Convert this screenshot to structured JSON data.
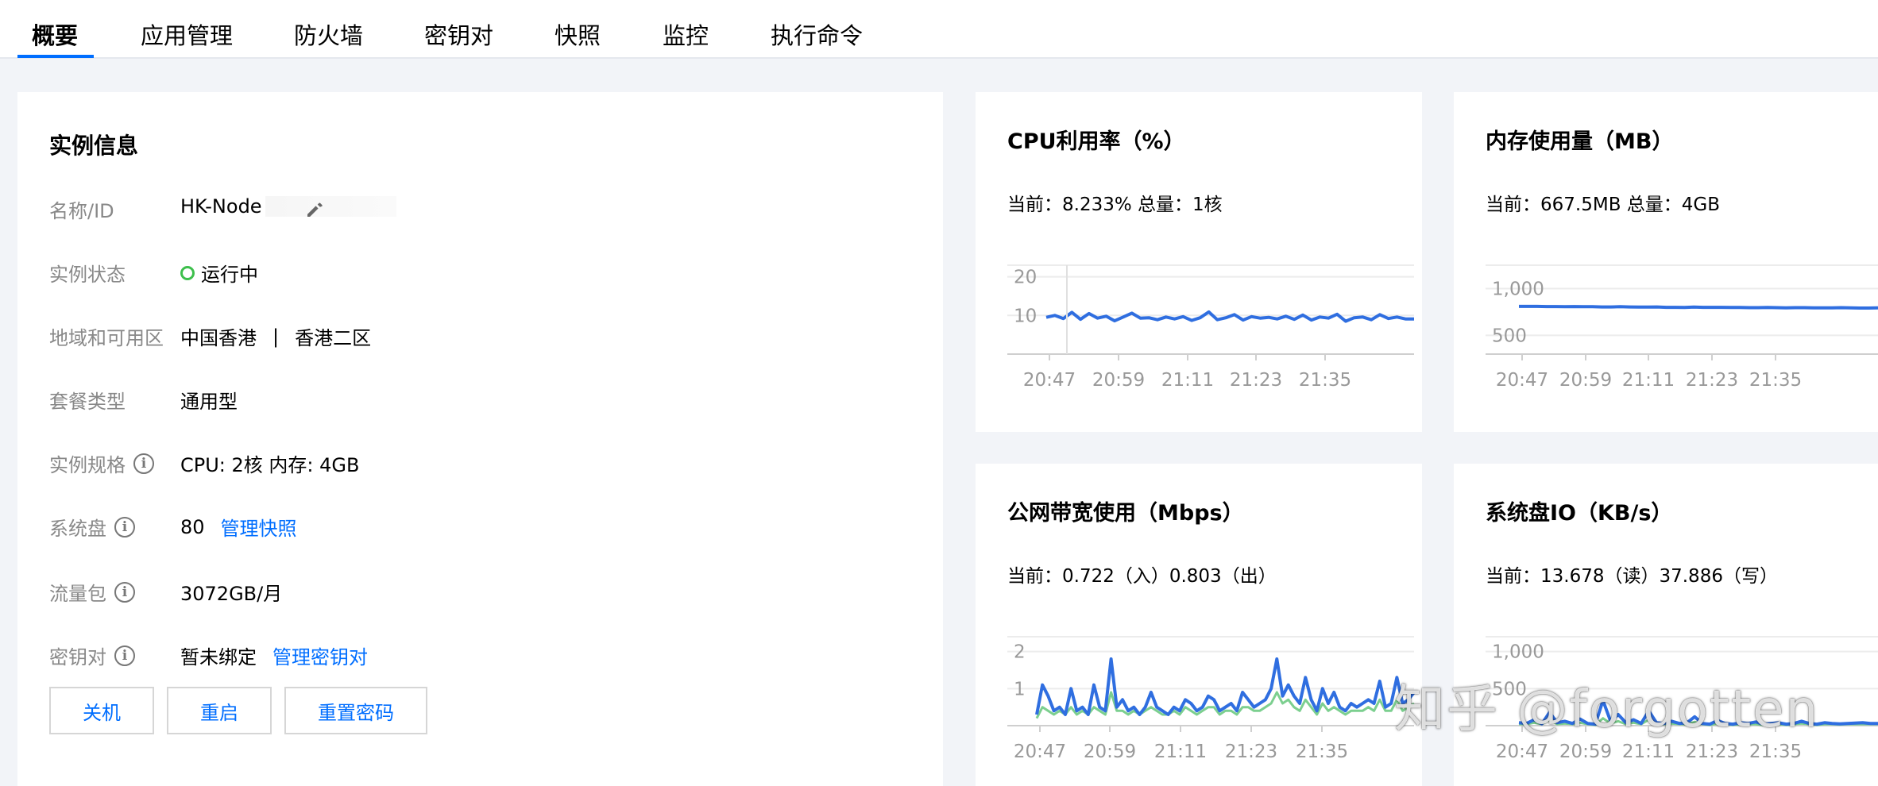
{
  "tabs": [
    {
      "label": "概要",
      "active": true
    },
    {
      "label": "应用管理"
    },
    {
      "label": "防火墙"
    },
    {
      "label": "密钥对"
    },
    {
      "label": "快照"
    },
    {
      "label": "监控"
    },
    {
      "label": "执行命令"
    }
  ],
  "instance": {
    "title": "实例信息",
    "name_label": "名称/ID",
    "name_value": "HK-Node",
    "status_label": "实例状态",
    "status_value": "运行中",
    "region_label": "地域和可用区",
    "region_value": "中国香港",
    "region_sep": "|",
    "zone_value": "香港二区",
    "plan_label": "套餐类型",
    "plan_value": "通用型",
    "spec_label": "实例规格",
    "spec_value": "CPU: 2核 内存: 4GB",
    "disk_label": "系统盘",
    "disk_value": "80",
    "disk_link": "管理快照",
    "traffic_label": "流量包",
    "traffic_value": "3072GB/月",
    "keypair_label": "密钥对",
    "keypair_value": "暂未绑定",
    "keypair_link": "管理密钥对",
    "buttons": {
      "shutdown": "关机",
      "restart": "重启",
      "reset_password": "重置密码"
    }
  },
  "colors": {
    "accent": "#006eff",
    "status_green": "#3dbf4c",
    "series_blue": "#2f6ee0",
    "series_green": "#7ccf8f"
  },
  "metrics": {
    "cpu": {
      "title": "CPU利用率（%）",
      "current": "当前：8.233% 总量：1核"
    },
    "memory": {
      "title": "内存使用量（MB）",
      "current": "当前：667.5MB 总量：4GB"
    },
    "bandwidth": {
      "title": "公网带宽使用（Mbps）",
      "current": "当前：0.722（入）0.803（出）"
    },
    "disk_io": {
      "title": "系统盘IO（KB/s）",
      "current": "当前：13.678（读）37.886（写）"
    }
  },
  "chart_data": [
    {
      "type": "line",
      "x": [
        "20:47",
        "20:59",
        "21:11",
        "21:23",
        "21:35"
      ],
      "ylim": [
        0,
        23
      ],
      "yticks": [
        10,
        20
      ],
      "series": [
        {
          "values": [
            9.5,
            10,
            9.2,
            10.8,
            9,
            10.5,
            9.3,
            9.8,
            8.6,
            9.6,
            10.6,
            9.3,
            9.4,
            8.9,
            9.6,
            9.1,
            9.7,
            8.7,
            9.4,
            10.9,
            8.9,
            9.4,
            10.2,
            8.8,
            9.7,
            9.3,
            9.5,
            9.1,
            9.8,
            9,
            10.1,
            8.8,
            9.6,
            9.3,
            10.3,
            8.5,
            9.4,
            9.6,
            8.9,
            10.2,
            9.2,
            9.6,
            9.1,
            9.1
          ]
        }
      ]
    },
    {
      "type": "line",
      "x": [
        "20:47",
        "20:59",
        "21:11",
        "21:23",
        "21:35"
      ],
      "ylim": [
        300,
        1250
      ],
      "yticks": [
        500,
        1000
      ],
      "series": [
        {
          "values": [
            810,
            810,
            810,
            808,
            808,
            806,
            808,
            806,
            806,
            804,
            804,
            806,
            804,
            802,
            802,
            804,
            800,
            800,
            798,
            802,
            800,
            800,
            800,
            798,
            798,
            796,
            796,
            798,
            796,
            794,
            796,
            796,
            794,
            794,
            794,
            796,
            794,
            792,
            792,
            794
          ]
        }
      ]
    },
    {
      "type": "line",
      "x": [
        "20:47",
        "20:59",
        "21:11",
        "21:23",
        "21:35"
      ],
      "ylim": [
        0,
        2.4
      ],
      "yticks": [
        1,
        2
      ],
      "series": [
        {
          "values": [
            0.3,
            1.1,
            0.8,
            0.4,
            0.5,
            0.3,
            1.0,
            0.4,
            0.5,
            0.3,
            1.1,
            0.5,
            0.4,
            1.8,
            0.5,
            0.7,
            0.4,
            0.5,
            0.3,
            0.5,
            0.9,
            0.5,
            0.4,
            0.3,
            0.5,
            0.4,
            0.7,
            0.6,
            0.4,
            0.5,
            0.8,
            0.7,
            0.4,
            0.5,
            0.6,
            0.4,
            0.9,
            0.7,
            0.5,
            0.6,
            0.7,
            1.0,
            1.8,
            0.8,
            1.1,
            0.8,
            0.6,
            1.3,
            0.7,
            0.4,
            1.0,
            0.6,
            0.9,
            0.5,
            0.4,
            0.6,
            0.5,
            0.6,
            0.7,
            0.6,
            1.2,
            0.5,
            0.6,
            1.3,
            0.6,
            0.7,
            0.9
          ]
        },
        {
          "values": [
            0.2,
            0.5,
            0.4,
            0.3,
            0.4,
            0.3,
            0.5,
            0.3,
            0.4,
            0.3,
            0.5,
            0.4,
            0.3,
            0.9,
            0.4,
            0.4,
            0.3,
            0.4,
            0.3,
            0.4,
            0.5,
            0.4,
            0.3,
            0.3,
            0.4,
            0.3,
            0.5,
            0.4,
            0.3,
            0.4,
            0.5,
            0.5,
            0.3,
            0.4,
            0.4,
            0.3,
            0.5,
            0.5,
            0.4,
            0.4,
            0.5,
            0.6,
            0.9,
            0.6,
            0.7,
            0.5,
            0.4,
            0.7,
            0.5,
            0.3,
            0.6,
            0.4,
            0.5,
            0.4,
            0.3,
            0.4,
            0.4,
            0.4,
            0.5,
            0.4,
            0.7,
            0.4,
            0.4,
            0.7,
            0.4,
            0.5,
            0.6
          ]
        }
      ]
    },
    {
      "type": "line",
      "x": [
        "20:47",
        "20:59",
        "21:11",
        "21:23",
        "21:35"
      ],
      "ylim": [
        0,
        1200
      ],
      "yticks": [
        500,
        1000
      ],
      "series": [
        {
          "values": [
            40,
            30,
            80,
            25,
            180,
            40,
            60,
            30,
            90,
            30,
            20,
            340,
            60,
            150,
            40,
            80,
            30,
            200,
            40,
            30,
            60,
            30,
            40,
            120,
            30,
            20,
            70,
            30,
            20,
            40,
            30,
            50,
            20,
            30,
            40,
            20,
            30,
            60,
            30,
            20,
            40,
            30,
            25,
            30,
            35,
            40,
            30,
            30
          ]
        },
        {
          "values": [
            20,
            20,
            40,
            20,
            80,
            20,
            30,
            20,
            40,
            20,
            10,
            100,
            30,
            60,
            20,
            40,
            20,
            80,
            20,
            20,
            30,
            20,
            20,
            50,
            20,
            10,
            30,
            20,
            10,
            20,
            20,
            20,
            10,
            20,
            20,
            10,
            20,
            30,
            20,
            10,
            20,
            20,
            15,
            20,
            20,
            20,
            20,
            20
          ]
        }
      ]
    }
  ],
  "watermark": "知乎 @forgotten"
}
